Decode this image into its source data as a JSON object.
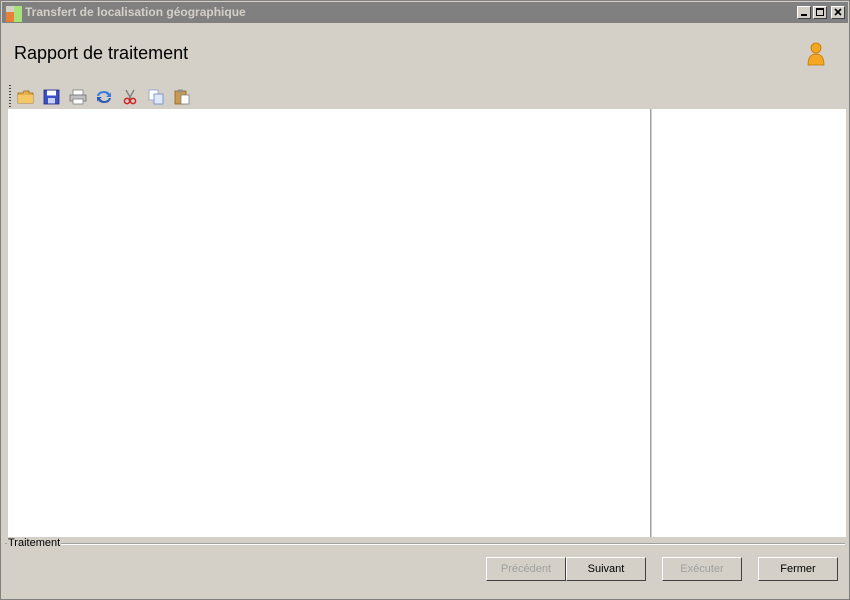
{
  "window": {
    "title": "Transfert de localisation géographique"
  },
  "header": {
    "title": "Rapport de traitement"
  },
  "toolbar": {
    "items": [
      {
        "name": "open-folder-icon"
      },
      {
        "name": "save-disk-icon"
      },
      {
        "name": "print-icon"
      },
      {
        "name": "refresh-icon"
      },
      {
        "name": "cut-icon"
      },
      {
        "name": "copy-icon"
      },
      {
        "name": "paste-icon"
      }
    ]
  },
  "group": {
    "label": "Traitement"
  },
  "buttons": {
    "previous": "Précédent",
    "next": "Suivant",
    "execute": "Exécuter",
    "close": "Fermer"
  },
  "colors": {
    "titlebar": "#808080",
    "face": "#d4d0c8",
    "content": "#ffffff"
  }
}
